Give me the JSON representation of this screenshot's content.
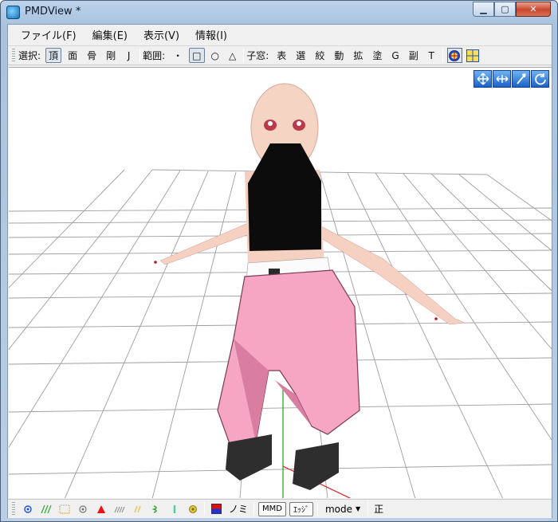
{
  "window": {
    "title": "PMDView *"
  },
  "menu": [
    {
      "label": "ファイル(F)"
    },
    {
      "label": "編集(E)"
    },
    {
      "label": "表示(V)"
    },
    {
      "label": "情報(I)"
    }
  ],
  "toolbar": {
    "select_label": "選択:",
    "select_items": [
      "頂",
      "面",
      "骨",
      "剛",
      "J"
    ],
    "range_label": "範囲:",
    "range_items": [
      "・",
      "□",
      "○",
      "△"
    ],
    "child_label": "子窓:",
    "child_items": [
      "表",
      "選",
      "絞",
      "動",
      "拡",
      "塗",
      "G",
      "副",
      "T"
    ]
  },
  "statusbar": {
    "mmd_label": "MMD",
    "edge_label": "ｴｯｼﾞ",
    "mode_label": "mode",
    "nomi_label": "ノミ",
    "sei_label": "正"
  }
}
